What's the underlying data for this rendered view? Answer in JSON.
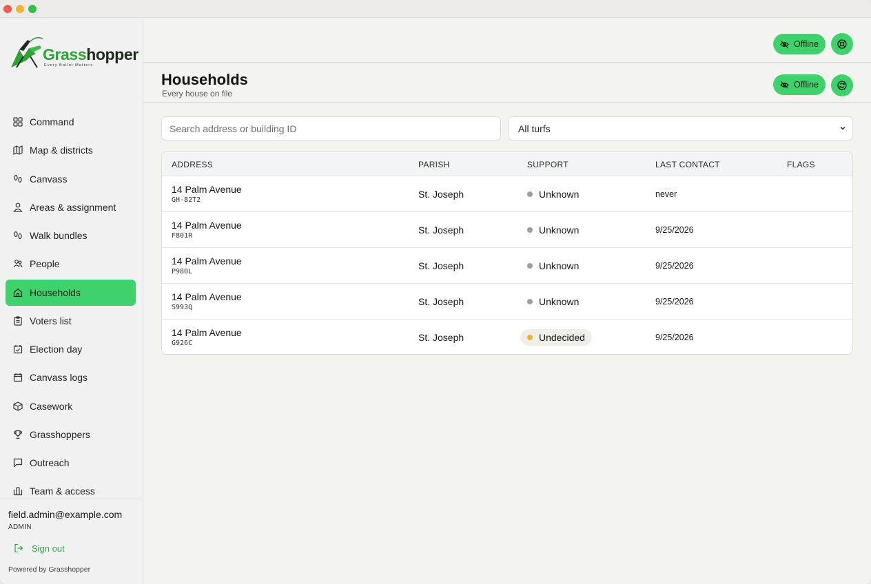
{
  "brand": {
    "name_part1": "Grass",
    "name_part2": "hopper",
    "tagline": "Every Ballot Matters"
  },
  "sidebar": {
    "items": [
      {
        "label": "Command",
        "icon": "grid-icon",
        "active": false
      },
      {
        "label": "Map & districts",
        "icon": "map-icon",
        "active": false
      },
      {
        "label": "Canvass",
        "icon": "footsteps-icon",
        "active": false
      },
      {
        "label": "Areas & assignment",
        "icon": "user-icon",
        "active": false
      },
      {
        "label": "Walk bundles",
        "icon": "footsteps-icon",
        "active": false
      },
      {
        "label": "People",
        "icon": "people-icon",
        "active": false
      },
      {
        "label": "Households",
        "icon": "home-icon",
        "active": true
      },
      {
        "label": "Voters list",
        "icon": "clipboard-icon",
        "active": false
      },
      {
        "label": "Election day",
        "icon": "calendar-check-icon",
        "active": false
      },
      {
        "label": "Canvass logs",
        "icon": "calendar-icon",
        "active": false
      },
      {
        "label": "Casework",
        "icon": "box-icon",
        "active": false
      },
      {
        "label": "Grasshoppers",
        "icon": "trophy-icon",
        "active": false
      },
      {
        "label": "Outreach",
        "icon": "message-icon",
        "active": false
      },
      {
        "label": "Team & access",
        "icon": "columns-icon",
        "active": false
      }
    ],
    "footer": {
      "email": "field.admin@example.com",
      "role": "ADMIN",
      "sign_out": "Sign out",
      "powered_by": "Powered by Grasshopper"
    }
  },
  "topbar": {
    "status_label": "Offline"
  },
  "page": {
    "title": "Households",
    "subtitle": "Every house on file",
    "status_label": "Offline"
  },
  "filters": {
    "search_placeholder": "Search address or building ID",
    "turf_selected": "All turfs"
  },
  "table": {
    "columns": [
      "ADDRESS",
      "PARISH",
      "SUPPORT",
      "LAST CONTACT",
      "FLAGS"
    ],
    "rows": [
      {
        "address": "14 Palm Avenue",
        "building_id": "GH-82T2",
        "parish": "St. Joseph",
        "support": "Unknown",
        "support_color": "#9e9e9e",
        "last_contact": "never",
        "flags": ""
      },
      {
        "address": "14 Palm Avenue",
        "building_id": "F801R",
        "parish": "St. Joseph",
        "support": "Unknown",
        "support_color": "#9e9e9e",
        "last_contact": "9/25/2026",
        "flags": ""
      },
      {
        "address": "14 Palm Avenue",
        "building_id": "P980L",
        "parish": "St. Joseph",
        "support": "Unknown",
        "support_color": "#9e9e9e",
        "last_contact": "9/25/2026",
        "flags": ""
      },
      {
        "address": "14 Palm Avenue",
        "building_id": "S993Q",
        "parish": "St. Joseph",
        "support": "Unknown",
        "support_color": "#9e9e9e",
        "last_contact": "9/25/2026",
        "flags": ""
      },
      {
        "address": "14 Palm Avenue",
        "building_id": "G926C",
        "parish": "St. Joseph",
        "support": "Undecided",
        "support_color": "#f0b429",
        "last_contact": "9/25/2026",
        "flags": ""
      }
    ]
  },
  "colors": {
    "accent": "#3fd26c",
    "brand_green": "#2fa238",
    "unknown": "#9e9e9e",
    "undecided": "#f0b429"
  }
}
